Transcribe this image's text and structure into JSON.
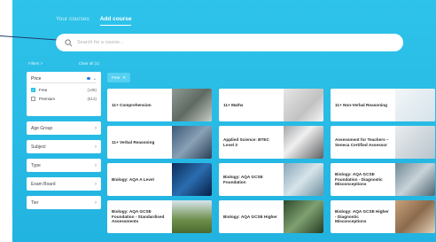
{
  "tabs": [
    {
      "label": "Your courses",
      "active": false
    },
    {
      "label": "Add course",
      "active": true
    }
  ],
  "search": {
    "placeholder": "Search for a course...",
    "icon": "search-icon"
  },
  "filters": {
    "label": "Filters >",
    "clear_label": "Clear all (1)"
  },
  "price": {
    "label": "Price",
    "options": [
      {
        "label": "Free",
        "count": "(136)",
        "checked": true
      },
      {
        "label": "Premium",
        "count": "(613)",
        "checked": false
      }
    ]
  },
  "facets": [
    "Age Group",
    "Subject",
    "Type",
    "Exam Board",
    "Tier"
  ],
  "active_chip": {
    "label": "Free",
    "remove_icon": "close-icon"
  },
  "courses": [
    {
      "title": "11+ Comprehension"
    },
    {
      "title": "11+ Maths"
    },
    {
      "title": "11+ Non-Verbal Reasoning"
    },
    {
      "title": "11+ Verbal Reasoning"
    },
    {
      "title": "Applied Science: BTEC Level 3"
    },
    {
      "title": "Assessment for Teachers – Seneca Certified Assessor"
    },
    {
      "title": "Biology: AQA A Level"
    },
    {
      "title": "Biology: AQA GCSE Foundation"
    },
    {
      "title": "Biology: AQA GCSE Foundation - Diagnostic Misconceptions"
    },
    {
      "title": "Biology: AQA GCSE Foundation - Standardised Assessments"
    },
    {
      "title": "Biology: AQA GCSE Higher"
    },
    {
      "title": "Biology: AQA GCSE Higher - Diagnostic Misconceptions"
    }
  ]
}
